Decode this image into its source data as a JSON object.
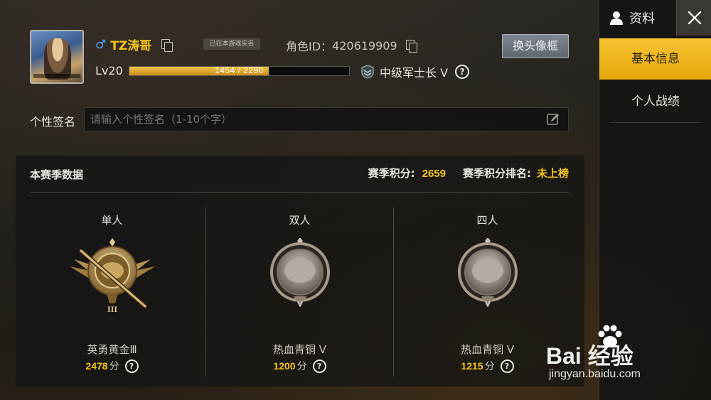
{
  "profile": {
    "gender_symbol": "♂",
    "name": "TZ涛哥",
    "realname_badge": "已在本游戏实名",
    "role_id_label": "角色ID：",
    "role_id": "420619909",
    "frame_button": "换头像框",
    "level": "Lv20",
    "xp_text": "1454 / 2290",
    "xp_progress": 0.635,
    "rank_title": "中级军士长 V",
    "help": "?"
  },
  "signature": {
    "label": "个性签名",
    "placeholder": "请输入个性签名（1-10个字）"
  },
  "season": {
    "title": "本赛季数据",
    "score_label": "赛季积分:",
    "score_value": "2659",
    "rank_label": "赛季积分排名:",
    "rank_value": "未上榜",
    "modes": [
      {
        "name": "单人",
        "tier": "英勇黄金Ⅲ",
        "points": "2478",
        "unit": "分",
        "badge": "gold-badge-icon"
      },
      {
        "name": "双人",
        "tier": "热血青铜 V",
        "points": "1200",
        "unit": "分",
        "badge": "bronze-badge-icon"
      },
      {
        "name": "四人",
        "tier": "热血青铜 V",
        "points": "1215",
        "unit": "分",
        "badge": "bronze-badge-icon"
      }
    ]
  },
  "sidebar": {
    "title": "资料",
    "tabs": [
      {
        "label": "基本信息",
        "active": true
      },
      {
        "label": "个人战绩",
        "active": false
      }
    ]
  },
  "watermark": {
    "brand": "Bai 经验",
    "url": "jingyan.baidu.com"
  },
  "colors": {
    "accent_gold": "#f5c518",
    "active_tab": "#f0b820",
    "gender_blue": "#4fa3ff"
  }
}
